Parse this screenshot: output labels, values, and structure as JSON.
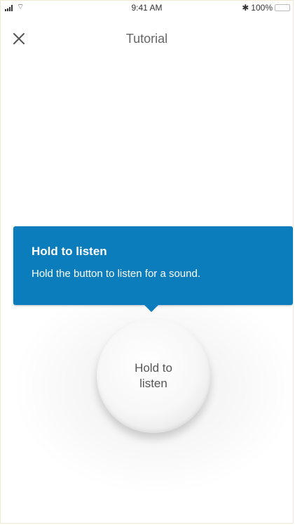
{
  "status_bar": {
    "time": "9:41 AM",
    "wifi_glyph": "⌔",
    "bluetooth_glyph": "✱",
    "battery_percent": "100%",
    "battery_level": 1.0
  },
  "nav": {
    "title": "Tutorial",
    "close_icon": "close-icon"
  },
  "tooltip": {
    "title": "Hold to listen",
    "body": "Hold the button to listen for a sound.",
    "color": "#0b7dbd"
  },
  "listen_button": {
    "label": "Hold to listen"
  }
}
